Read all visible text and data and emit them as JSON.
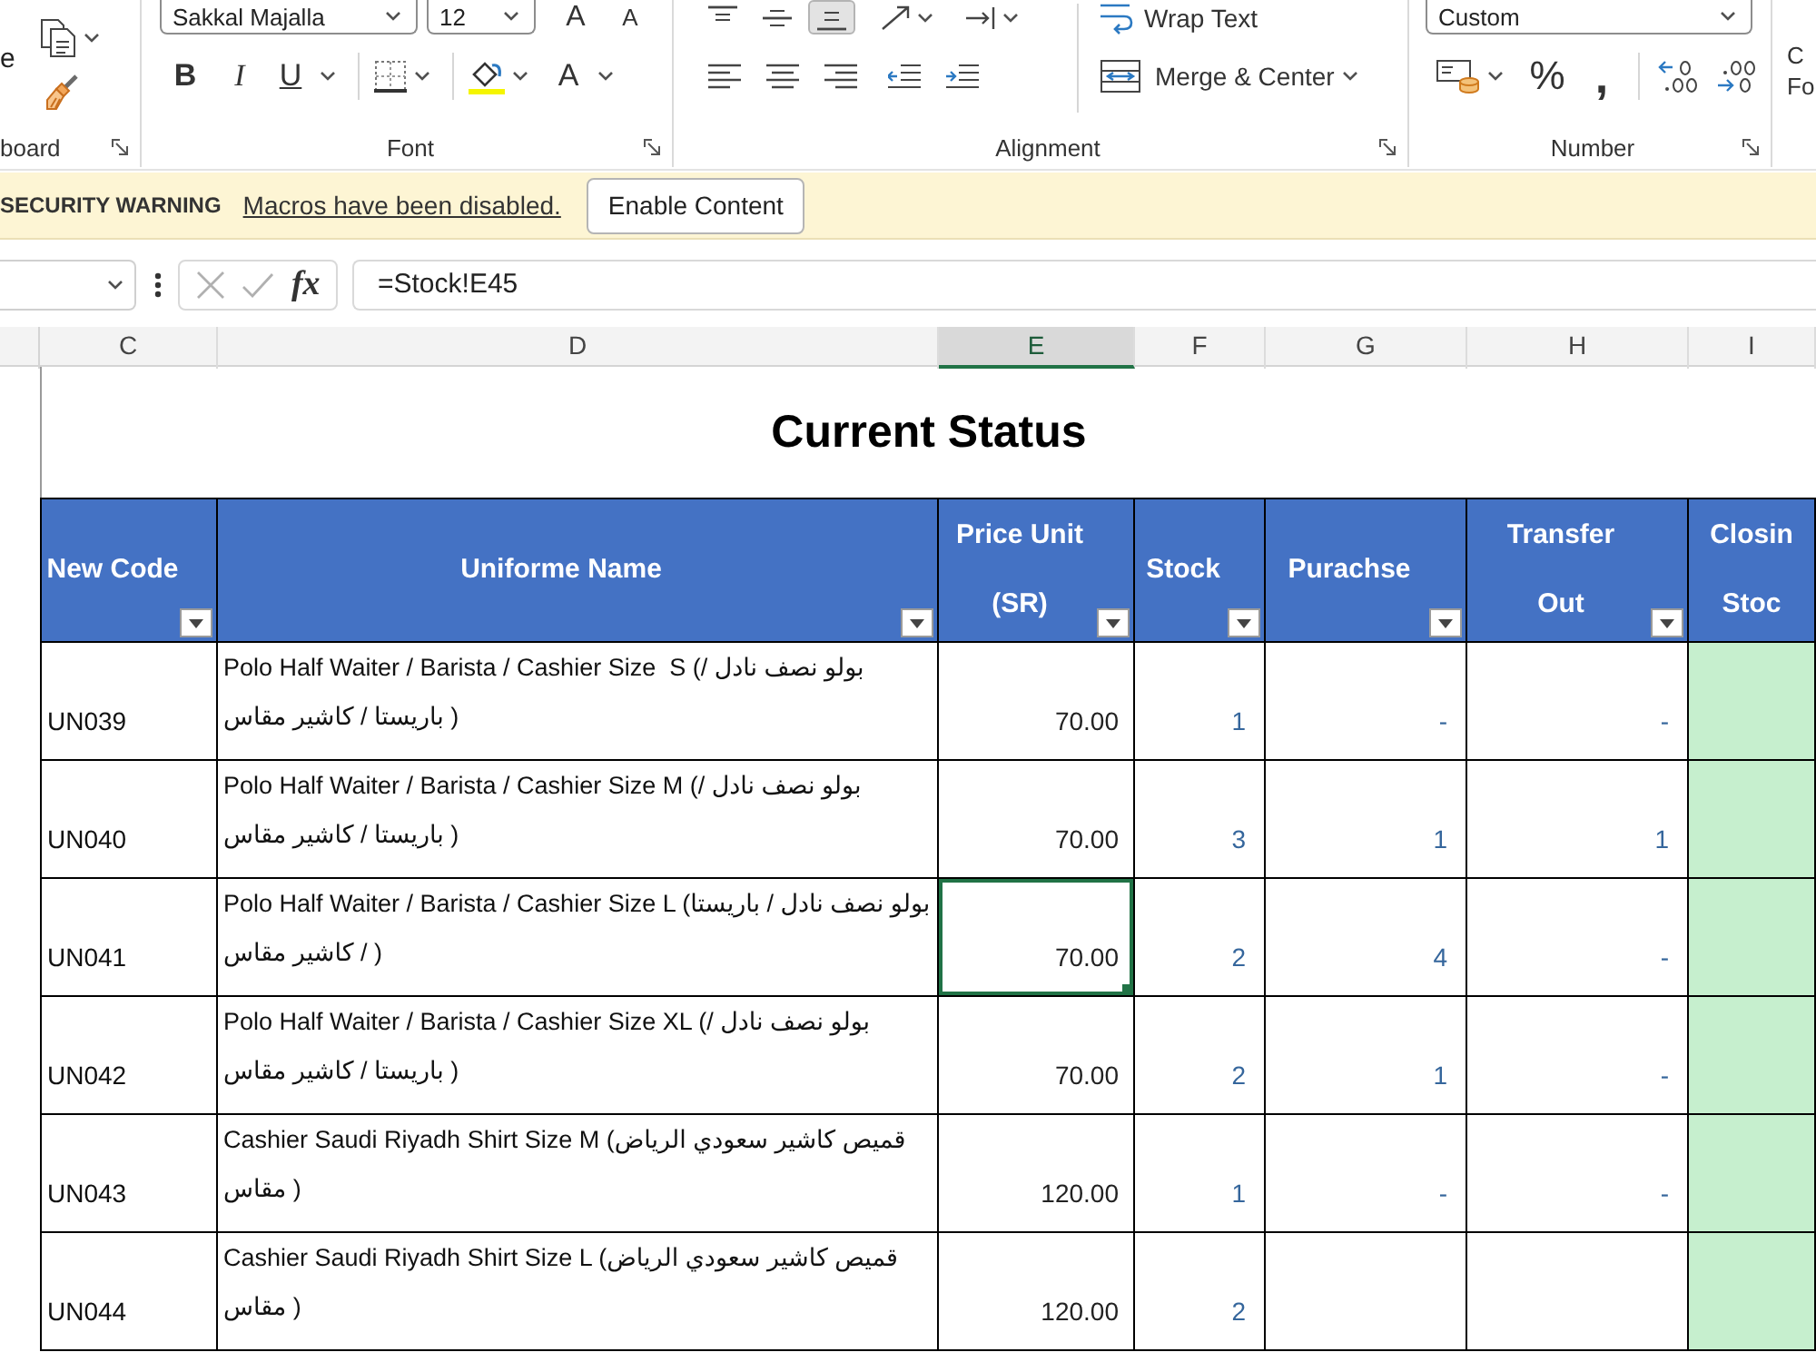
{
  "ribbon": {
    "clipboard": {
      "paste": "e",
      "label": "board"
    },
    "font": {
      "font_name": "Sakkal Majalla",
      "font_size": "12",
      "grow": "A",
      "shrink": "A",
      "bold": "B",
      "italic": "I",
      "underline": "U",
      "font_color": "A",
      "label": "Font"
    },
    "alignment": {
      "vertical": [
        {
          "kind": "top",
          "selected": false
        },
        {
          "kind": "middle",
          "selected": false
        },
        {
          "kind": "bottom",
          "selected": true
        }
      ],
      "horizontal": [
        {
          "kind": "left",
          "selected": false
        },
        {
          "kind": "center",
          "selected": false
        },
        {
          "kind": "right",
          "selected": false
        }
      ],
      "wrap_text": "Wrap Text",
      "merge": "Merge & Center",
      "label": "Alignment"
    },
    "number": {
      "format": "Custom",
      "percent": "%",
      "comma": ",",
      "label": "Number"
    },
    "styles": {
      "conditional_formatting": "C Fo"
    }
  },
  "security_bar": {
    "title": "SECURITY WARNING",
    "message": "Macros have been disabled.",
    "button": "Enable Content"
  },
  "formula_bar": {
    "insert_function": "fx",
    "formula": "=Stock!E45"
  },
  "column_headers": [
    {
      "letter": "C",
      "selected": false
    },
    {
      "letter": "D",
      "selected": false
    },
    {
      "letter": "E",
      "selected": true
    },
    {
      "letter": "F",
      "selected": false
    },
    {
      "letter": "G",
      "selected": false
    },
    {
      "letter": "H",
      "selected": false
    },
    {
      "letter": "I",
      "selected": false
    }
  ],
  "sheet": {
    "title": "Current Status",
    "columns": [
      {
        "label": "New Code",
        "kind": "code",
        "filter": true
      },
      {
        "label": "Uniforme Name",
        "kind": "name",
        "filter": true
      },
      {
        "label": "Price Unit (SR)",
        "kind": "price",
        "filter": true
      },
      {
        "label": "Stock",
        "kind": "count",
        "filter": true
      },
      {
        "label": "Purachse",
        "kind": "count",
        "filter": true
      },
      {
        "label": "Transfer Out",
        "kind": "count",
        "filter": true
      },
      {
        "label": "Closin Stoc",
        "kind": "closing",
        "filter": false
      }
    ],
    "rows": [
      {
        "cells": [
          {
            "text": "UN039",
            "selected": false
          },
          {
            "text": "Polo Half Waiter / Barista / Cashier Size  S (بولو نصف نادل / باريستا / كاشير مقاس )",
            "selected": false
          },
          {
            "text": "70.00",
            "selected": false
          },
          {
            "text": "1",
            "selected": false
          },
          {
            "text": "-",
            "selected": false
          },
          {
            "text": "-",
            "selected": false
          },
          {
            "selected": false
          }
        ]
      },
      {
        "cells": [
          {
            "text": "UN040",
            "selected": false
          },
          {
            "text": "Polo Half Waiter / Barista / Cashier Size M (بولو نصف نادل / باريستا / كاشير مقاس )",
            "selected": false
          },
          {
            "text": "70.00",
            "selected": false
          },
          {
            "text": "3",
            "selected": false
          },
          {
            "text": "1",
            "selected": false
          },
          {
            "text": "1",
            "selected": false
          },
          {
            "selected": false
          }
        ]
      },
      {
        "cells": [
          {
            "text": "UN041",
            "selected": false
          },
          {
            "text": "Polo Half Waiter / Barista / Cashier Size L (بولو نصف نادل / باريستا / كاشير مقاس )",
            "selected": false
          },
          {
            "text": "70.00",
            "selected": true
          },
          {
            "text": "2",
            "selected": false
          },
          {
            "text": "4",
            "selected": false
          },
          {
            "text": "-",
            "selected": false
          },
          {
            "selected": false
          }
        ]
      },
      {
        "cells": [
          {
            "text": "UN042",
            "selected": false
          },
          {
            "text": "Polo Half Waiter / Barista / Cashier Size XL (بولو نصف نادل / باريستا / كاشير مقاس )",
            "selected": false
          },
          {
            "text": "70.00",
            "selected": false
          },
          {
            "text": "2",
            "selected": false
          },
          {
            "text": "1",
            "selected": false
          },
          {
            "text": "-",
            "selected": false
          },
          {
            "selected": false
          }
        ]
      },
      {
        "cells": [
          {
            "text": "UN043",
            "selected": false
          },
          {
            "text": "Cashier Saudi Riyadh Shirt Size M (قميص كاشير سعودي الرياض مقاس )",
            "selected": false
          },
          {
            "text": "120.00",
            "selected": false
          },
          {
            "text": "1",
            "selected": false
          },
          {
            "text": "-",
            "selected": false
          },
          {
            "text": "-",
            "selected": false
          },
          {
            "selected": false
          }
        ]
      },
      {
        "cells": [
          {
            "text": "UN044",
            "selected": false
          },
          {
            "text": "Cashier Saudi Riyadh Shirt Size L (قميص كاشير سعودي الرياض مقاس )",
            "selected": false
          },
          {
            "text": "120.00",
            "selected": false
          },
          {
            "text": "2",
            "selected": false
          },
          {
            "selected": false
          },
          {
            "selected": false
          },
          {
            "selected": false
          }
        ]
      }
    ]
  }
}
